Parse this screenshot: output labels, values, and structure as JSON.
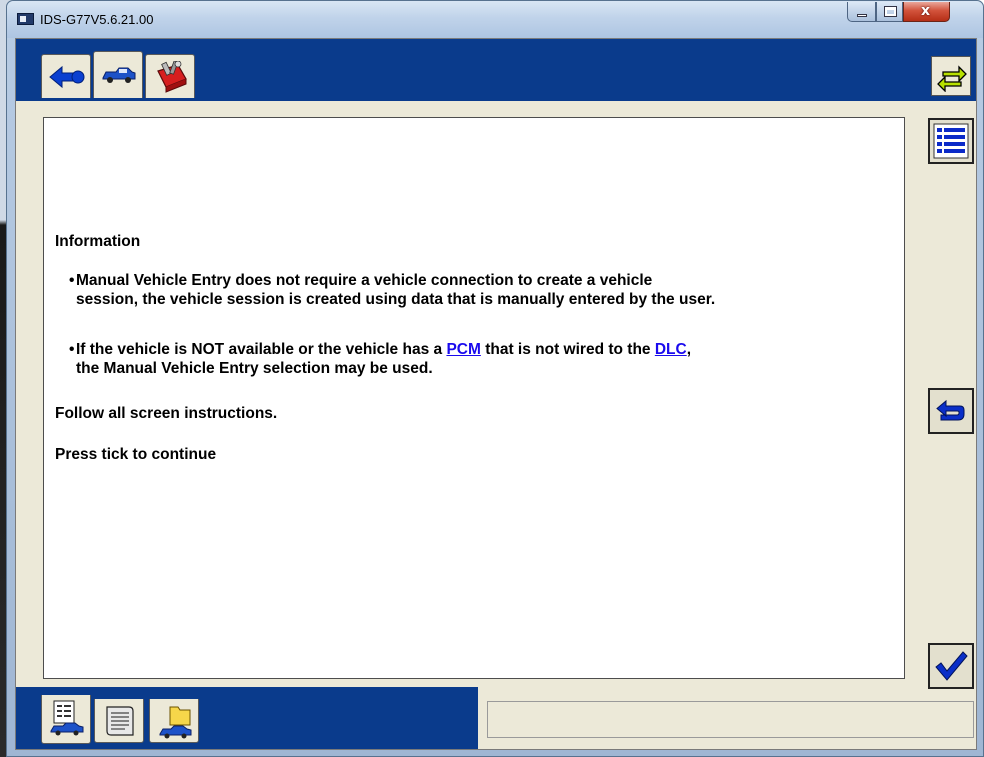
{
  "window": {
    "title": "IDS-G77V5.6.21.00"
  },
  "window_controls": {
    "minimize": "minimize",
    "maximize": "maximize",
    "close": "x"
  },
  "top_tabs": [
    {
      "icon": "back-arrow-icon"
    },
    {
      "icon": "vehicle-icon"
    },
    {
      "icon": "toolbox-icon"
    }
  ],
  "content": {
    "heading": "Information",
    "bullet1": {
      "line1": "Manual Vehicle Entry does not require a vehicle connection to create a vehicle",
      "line2": "session, the vehicle session is created using data that is manually entered by the user."
    },
    "bullet2": {
      "pre": "If the vehicle is NOT available or the vehicle has a ",
      "link1": "PCM",
      "mid": " that is not wired to the ",
      "link2": "DLC",
      "post": ",",
      "line2": "the Manual Vehicle Entry selection may be used."
    },
    "follow": "Follow all screen instructions.",
    "press": "Press tick to continue"
  },
  "side_buttons": [
    "list-icon",
    "return-icon",
    "tick-icon"
  ],
  "bottom_tabs": [
    "vehicle-data-icon",
    "notes-icon",
    "vehicle-folder-icon"
  ],
  "status_text": "",
  "colors": {
    "nav_bar": "#0a3b8c",
    "panel": "#ece9d8",
    "link": "#1a0aee",
    "accent_blue": "#0033cc"
  }
}
